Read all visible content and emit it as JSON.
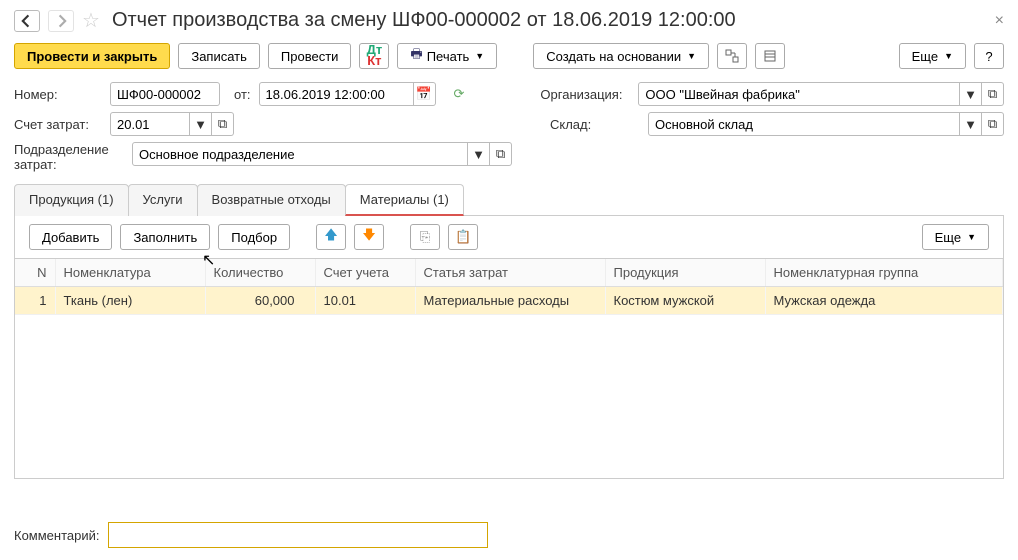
{
  "title": "Отчет производства за смену ШФ00-000002 от 18.06.2019 12:00:00",
  "toolbar": {
    "post_close": "Провести и закрыть",
    "save": "Записать",
    "post": "Провести",
    "print": "Печать",
    "create_based": "Создать на основании",
    "more": "Еще",
    "help": "?"
  },
  "labels": {
    "number": "Номер:",
    "from": "от:",
    "organization": "Организация:",
    "cost_account": "Счет затрат:",
    "warehouse": "Склад:",
    "department": "Подразделение затрат:",
    "comment": "Комментарий:"
  },
  "fields": {
    "number": "ШФ00-000002",
    "date": "18.06.2019 12:00:00",
    "organization": "ООО \"Швейная фабрика\"",
    "cost_account": "20.01",
    "warehouse": "Основной склад",
    "department": "Основное подразделение",
    "comment": ""
  },
  "tabs": [
    {
      "label": "Продукция (1)",
      "active": false
    },
    {
      "label": "Услуги",
      "active": false
    },
    {
      "label": "Возвратные отходы",
      "active": false
    },
    {
      "label": "Материалы (1)",
      "active": true
    }
  ],
  "grid_toolbar": {
    "add": "Добавить",
    "fill": "Заполнить",
    "select": "Подбор",
    "more": "Еще"
  },
  "grid": {
    "columns": [
      "N",
      "Номенклатура",
      "Количество",
      "Счет учета",
      "Статья затрат",
      "Продукция",
      "Номенклатурная группа"
    ],
    "rows": [
      {
        "n": 1,
        "item": "Ткань (лен)",
        "qty": "60,000",
        "account": "10.01",
        "cost_item": "Материальные расходы",
        "product": "Костюм мужской",
        "group": "Мужская одежда"
      }
    ]
  }
}
